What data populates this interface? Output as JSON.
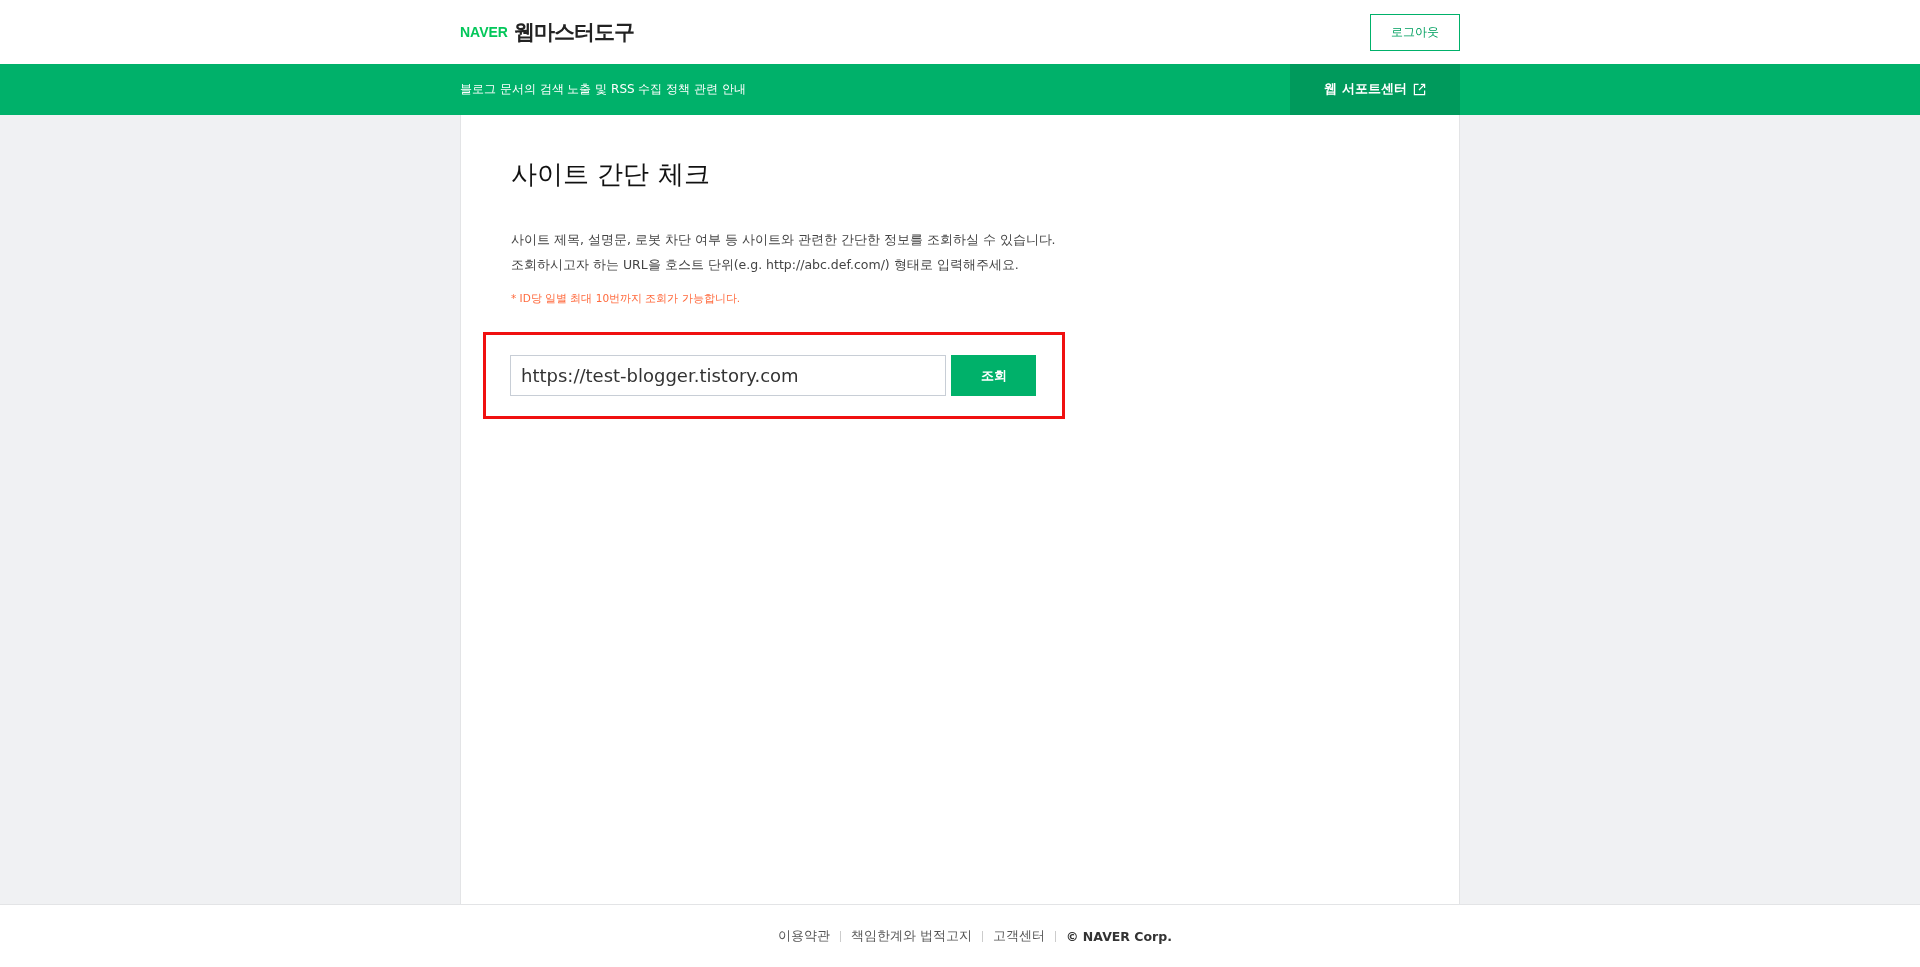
{
  "header": {
    "logo_brand": "NAVER",
    "logo_title": "웹마스터도구",
    "logout_button": "로그아웃"
  },
  "notice_bar": {
    "text": "블로그 문서의 검색 노출 및 RSS 수집 정책 관련 안내",
    "support_link": "웹 서포트센터"
  },
  "main": {
    "title": "사이트 간단 체크",
    "description": [
      "사이트 제목, 설명문, 로봇 차단 여부 등 사이트와 관련한 간단한 정보를 조회하실 수 있습니다.",
      "조회하시고자 하는 URL을 호스트 단위(e.g. http://abc.def.com/) 형태로 입력해주세요."
    ],
    "note": "* ID당 일별 최대 10번까지 조회가 가능합니다.",
    "search": {
      "value": "https://test-blogger.tistory.com",
      "button": "조회",
      "highlighted": true
    }
  },
  "footer": {
    "links": [
      "이용약관",
      "책임한계와 법적고지",
      "고객센터"
    ],
    "copyright": "© NAVER Corp."
  }
}
